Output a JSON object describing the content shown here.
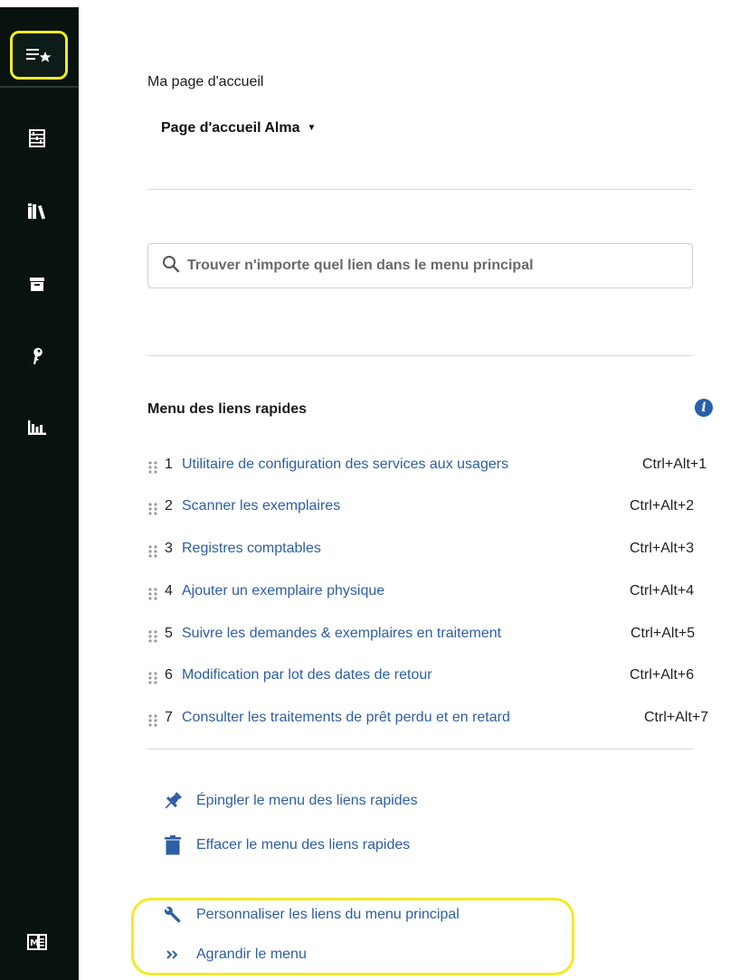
{
  "sidebar": {
    "items": [
      {
        "name": "starred-menu-icon",
        "active": true
      },
      {
        "name": "abacus-icon"
      },
      {
        "name": "library-icon"
      },
      {
        "name": "archive-icon"
      },
      {
        "name": "key-icon"
      },
      {
        "name": "bar-chart-icon"
      }
    ],
    "bottom_icon": "manual-icon"
  },
  "home": {
    "title": "Ma page d'accueil",
    "dropdown_value": "Page d'accueil Alma",
    "caret": "▼"
  },
  "search": {
    "placeholder": "Trouver n'importe quel lien dans le menu principal"
  },
  "quick_links": {
    "title": "Menu des liens rapides",
    "info": "i",
    "items": [
      {
        "num": "1",
        "label": "Utilitaire de configuration des services aux usagers",
        "shortcut": "Ctrl+Alt+1"
      },
      {
        "num": "2",
        "label": "Scanner les exemplaires",
        "shortcut": "Ctrl+Alt+2"
      },
      {
        "num": "3",
        "label": "Registres comptables",
        "shortcut": "Ctrl+Alt+3"
      },
      {
        "num": "4",
        "label": "Ajouter un exemplaire physique",
        "shortcut": "Ctrl+Alt+4"
      },
      {
        "num": "5",
        "label": "Suivre les demandes & exemplaires en traitement",
        "shortcut": "Ctrl+Alt+5"
      },
      {
        "num": "6",
        "label": "Modification par lot des dates de retour",
        "shortcut": "Ctrl+Alt+6"
      },
      {
        "num": "7",
        "label": "Consulter les traitements de prêt perdu et en retard",
        "shortcut": "Ctrl+Alt+7"
      }
    ]
  },
  "actions": {
    "pin": "Épingler le menu des liens rapides",
    "clear": "Effacer le menu des liens rapides",
    "customize": "Personnaliser les liens du menu principal",
    "expand": "Agrandir le menu"
  },
  "colors": {
    "sidebar_bg": "#08120f",
    "link": "#2d5ea6",
    "highlight": "#f2ea27",
    "info": "#2760a8"
  }
}
